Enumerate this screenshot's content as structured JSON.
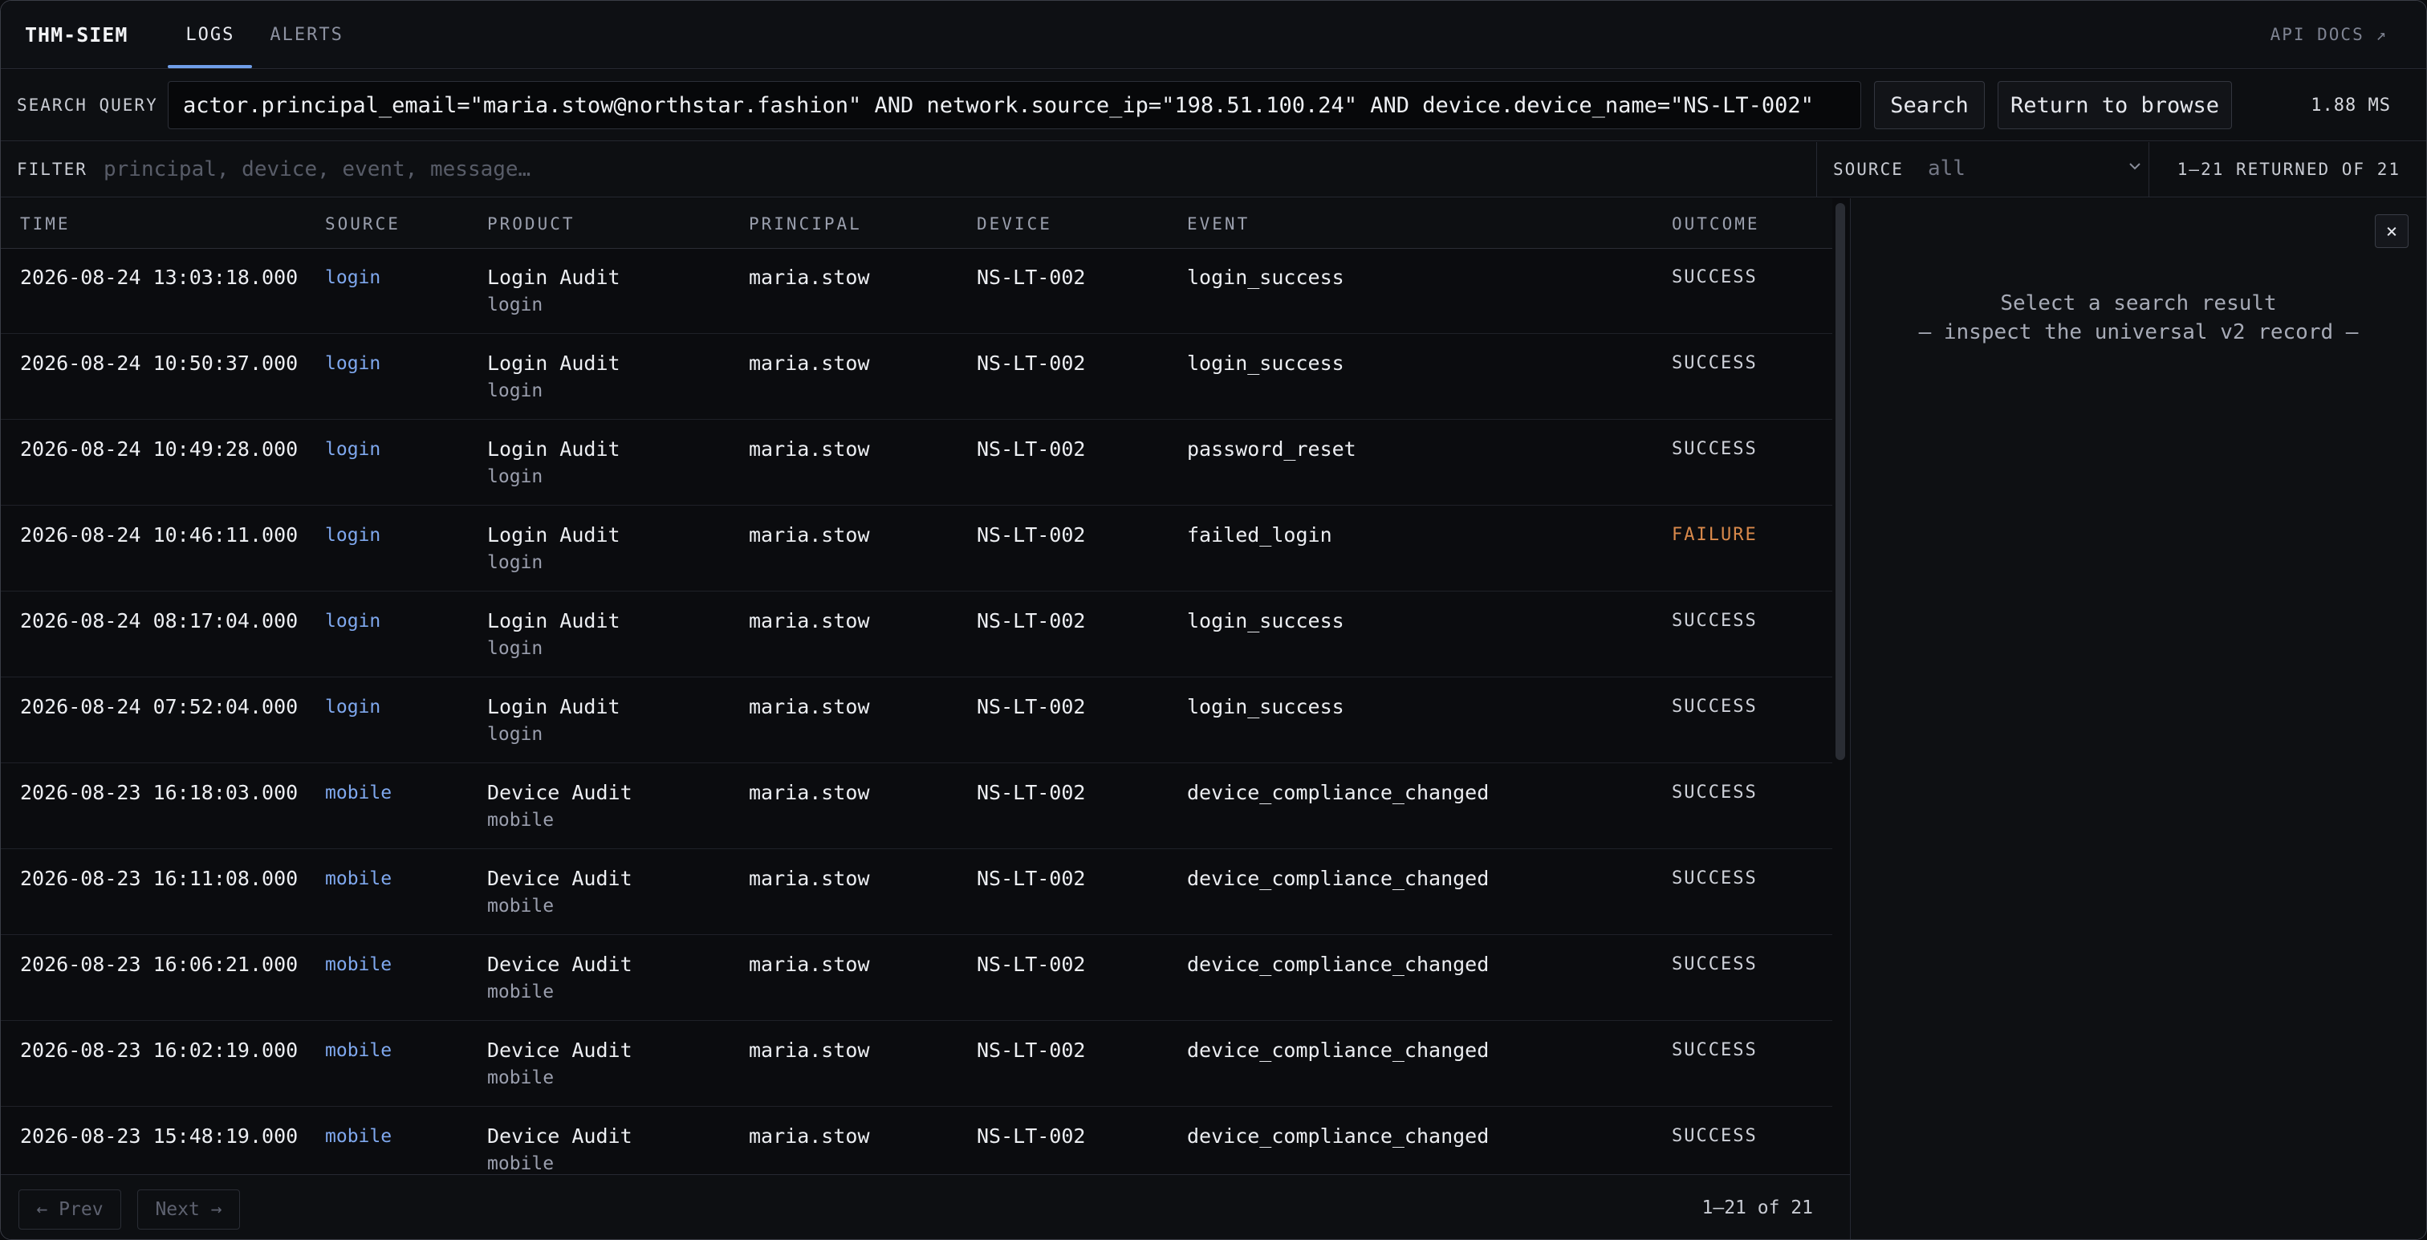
{
  "brand": "THM-SIEM",
  "nav": {
    "logs": "LOGS",
    "alerts": "ALERTS",
    "api_docs": "API DOCS ↗"
  },
  "search": {
    "label": "SEARCH QUERY",
    "query": "actor.principal_email=\"maria.stow@northstar.fashion\" AND network.source_ip=\"198.51.100.24\" AND device.device_name=\"NS-LT-002\"",
    "search_button": "Search",
    "return_button": "Return to browse",
    "elapsed": "1.88 MS"
  },
  "filter": {
    "label": "FILTER",
    "placeholder": "principal, device, event, message…",
    "source_label": "SOURCE",
    "source_value": "all",
    "returned": "1–21 RETURNED OF 21"
  },
  "table": {
    "headers": [
      "TIME",
      "SOURCE",
      "PRODUCT",
      "PRINCIPAL",
      "DEVICE",
      "EVENT",
      "OUTCOME"
    ],
    "rows": [
      {
        "time": "2026-08-24 13:03:18.000",
        "source": "login",
        "product": "Login Audit",
        "product_sub": "login",
        "principal": "maria.stow",
        "device": "NS-LT-002",
        "event": "login_success",
        "outcome": "SUCCESS"
      },
      {
        "time": "2026-08-24 10:50:37.000",
        "source": "login",
        "product": "Login Audit",
        "product_sub": "login",
        "principal": "maria.stow",
        "device": "NS-LT-002",
        "event": "login_success",
        "outcome": "SUCCESS"
      },
      {
        "time": "2026-08-24 10:49:28.000",
        "source": "login",
        "product": "Login Audit",
        "product_sub": "login",
        "principal": "maria.stow",
        "device": "NS-LT-002",
        "event": "password_reset",
        "outcome": "SUCCESS"
      },
      {
        "time": "2026-08-24 10:46:11.000",
        "source": "login",
        "product": "Login Audit",
        "product_sub": "login",
        "principal": "maria.stow",
        "device": "NS-LT-002",
        "event": "failed_login",
        "outcome": "FAILURE"
      },
      {
        "time": "2026-08-24 08:17:04.000",
        "source": "login",
        "product": "Login Audit",
        "product_sub": "login",
        "principal": "maria.stow",
        "device": "NS-LT-002",
        "event": "login_success",
        "outcome": "SUCCESS"
      },
      {
        "time": "2026-08-24 07:52:04.000",
        "source": "login",
        "product": "Login Audit",
        "product_sub": "login",
        "principal": "maria.stow",
        "device": "NS-LT-002",
        "event": "login_success",
        "outcome": "SUCCESS"
      },
      {
        "time": "2026-08-23 16:18:03.000",
        "source": "mobile",
        "product": "Device Audit",
        "product_sub": "mobile",
        "principal": "maria.stow",
        "device": "NS-LT-002",
        "event": "device_compliance_changed",
        "outcome": "SUCCESS"
      },
      {
        "time": "2026-08-23 16:11:08.000",
        "source": "mobile",
        "product": "Device Audit",
        "product_sub": "mobile",
        "principal": "maria.stow",
        "device": "NS-LT-002",
        "event": "device_compliance_changed",
        "outcome": "SUCCESS"
      },
      {
        "time": "2026-08-23 16:06:21.000",
        "source": "mobile",
        "product": "Device Audit",
        "product_sub": "mobile",
        "principal": "maria.stow",
        "device": "NS-LT-002",
        "event": "device_compliance_changed",
        "outcome": "SUCCESS"
      },
      {
        "time": "2026-08-23 16:02:19.000",
        "source": "mobile",
        "product": "Device Audit",
        "product_sub": "mobile",
        "principal": "maria.stow",
        "device": "NS-LT-002",
        "event": "device_compliance_changed",
        "outcome": "SUCCESS"
      },
      {
        "time": "2026-08-23 15:48:19.000",
        "source": "mobile",
        "product": "Device Audit",
        "product_sub": "mobile",
        "principal": "maria.stow",
        "device": "NS-LT-002",
        "event": "device_compliance_changed",
        "outcome": "SUCCESS"
      }
    ]
  },
  "pager": {
    "prev": "← Prev",
    "next": "Next →",
    "count": "1–21 of 21"
  },
  "detail": {
    "close": "×",
    "hint_line1": "Select a search result",
    "hint_line2": "— inspect the universal v2 record —"
  },
  "colors": {
    "accent": "#6f9de8",
    "source_link": "#7fa8ee",
    "failure": "#d9894b"
  }
}
